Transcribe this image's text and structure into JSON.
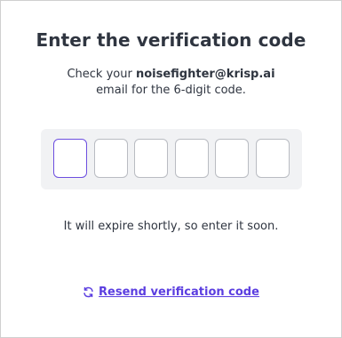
{
  "title": "Enter the verification code",
  "instruction": {
    "prefix": "Check your ",
    "email": "noisefighter@krisp.ai",
    "suffix": "email for the 6-digit code."
  },
  "code": {
    "digits": [
      "",
      "",
      "",
      "",
      "",
      ""
    ],
    "active_index": 0
  },
  "expire_text": "It will expire shortly, so enter it soon.",
  "resend": {
    "label": "Resend verification code",
    "icon": "refresh-icon"
  },
  "colors": {
    "accent": "#5b3ee0",
    "text": "#2f3540",
    "code_bg": "#f1f2f4",
    "input_border": "#b9bcc2"
  }
}
